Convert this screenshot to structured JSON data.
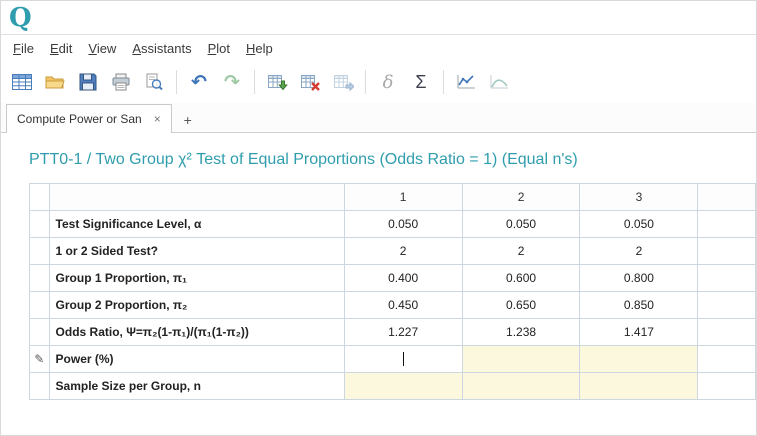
{
  "window": {
    "logo": "Q"
  },
  "menu": {
    "items": [
      "File",
      "Edit",
      "View",
      "Assistants",
      "Plot",
      "Help"
    ]
  },
  "toolbar": {
    "icons": [
      "new-table-icon",
      "open-folder-icon",
      "save-icon",
      "print-icon",
      "print-preview-icon",
      "undo-icon",
      "redo-icon",
      "run-table-icon",
      "delete-column-icon",
      "transfer-table-icon",
      "delta-icon",
      "sigma-icon",
      "plot-line-icon",
      "plot-curve-icon"
    ],
    "undo": "↶",
    "redo": "↷",
    "delta": "δ",
    "sigma": "Σ"
  },
  "tabs": {
    "active_label": "Compute Power or San",
    "close": "×",
    "new_tab": "+"
  },
  "content": {
    "title": "PTT0-1 / Two Group χ² Test of Equal Proportions (Odds Ratio = 1) (Equal n's)"
  },
  "table": {
    "edit_pencil": "✎",
    "columns": [
      "1",
      "2",
      "3"
    ],
    "rows": [
      {
        "label": "Test Significance Level, α",
        "values": [
          "0.050",
          "0.050",
          "0.050"
        ]
      },
      {
        "label": "1 or 2 Sided Test?",
        "values": [
          "2",
          "2",
          "2"
        ]
      },
      {
        "label": "Group 1 Proportion, π₁",
        "values": [
          "0.400",
          "0.600",
          "0.800"
        ]
      },
      {
        "label": "Group 2 Proportion, π₂",
        "values": [
          "0.450",
          "0.650",
          "0.850"
        ]
      },
      {
        "label": "Odds Ratio, Ψ=π₂(1-π₁)/(π₁(1-π₂))",
        "values": [
          "1.227",
          "1.238",
          "1.417"
        ]
      },
      {
        "label": "Power (%)",
        "values": [
          "",
          "",
          ""
        ]
      },
      {
        "label": "Sample Size per Group, n",
        "values": [
          "",
          "",
          ""
        ]
      }
    ]
  },
  "colors": {
    "accent_teal": "#2f9dad",
    "edit_cell_bg": "#fbf8de",
    "grid_border": "#ccd7e1"
  }
}
